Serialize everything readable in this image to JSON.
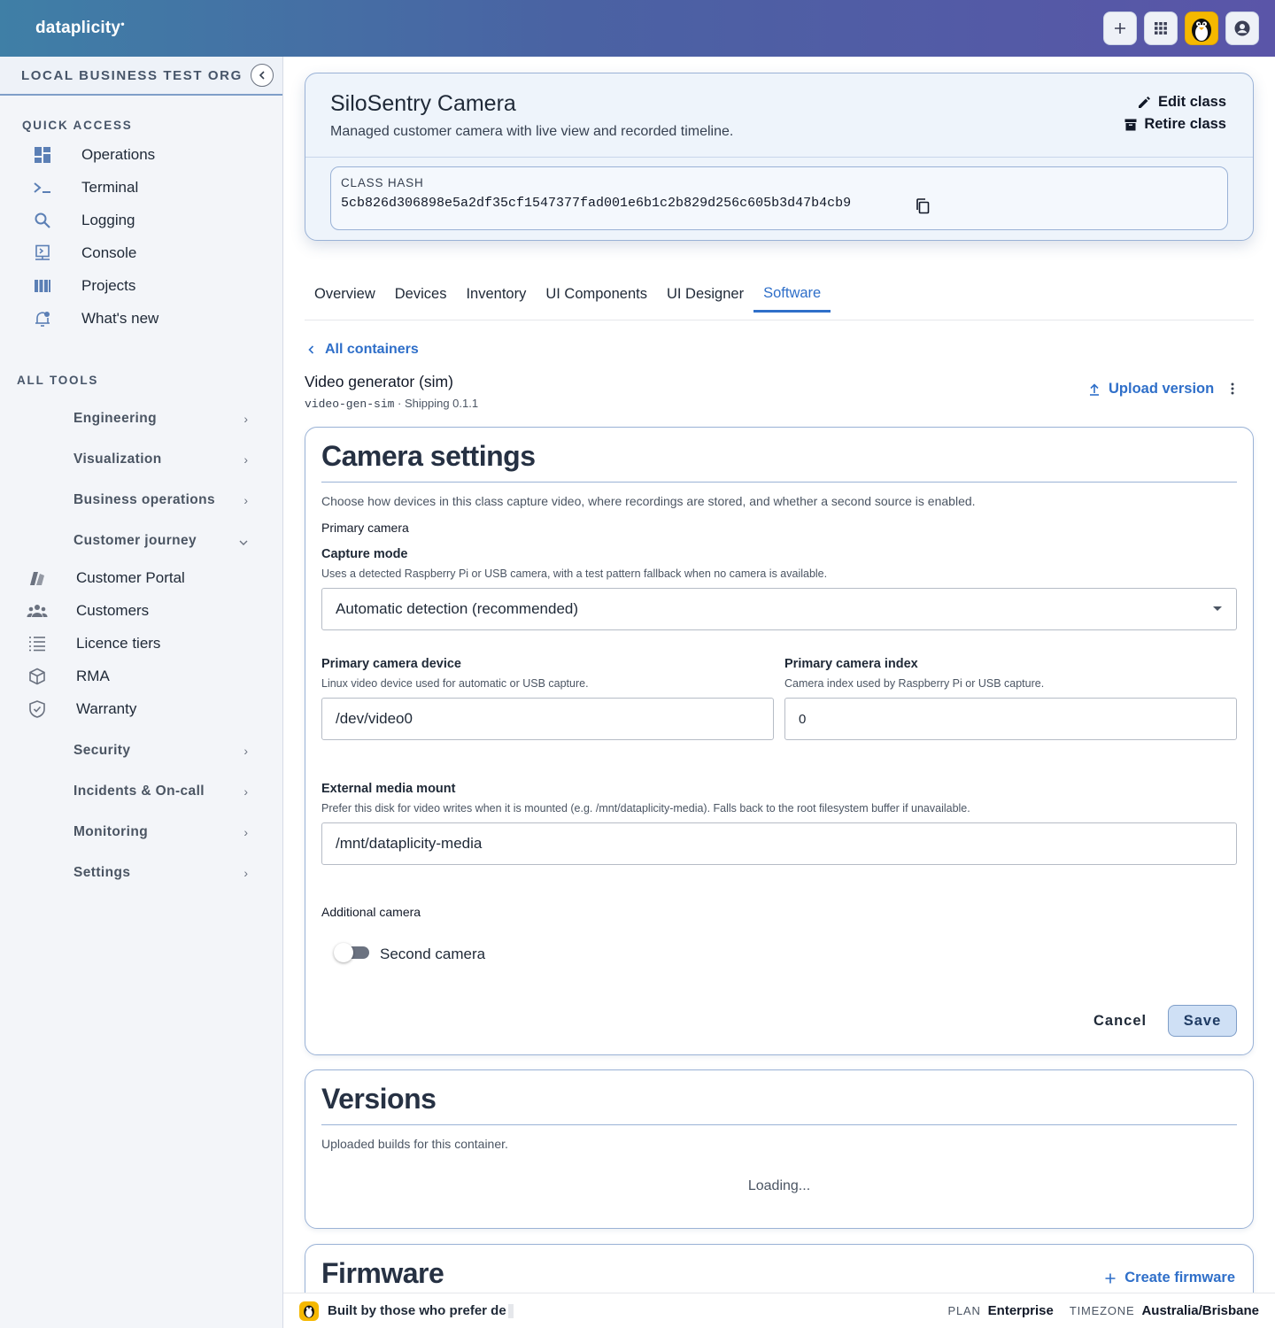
{
  "app": {
    "brand": "dataplicity"
  },
  "colors": {
    "accent": "#2f6fc9",
    "topbar_start": "#3f7fa6",
    "topbar_end": "#5a55a8",
    "panel_border": "#9ab2d6"
  },
  "topbar": {
    "actions": [
      "plus-icon",
      "apps-grid-icon",
      "penguin-avatar",
      "account-icon"
    ]
  },
  "sidebar": {
    "org_name": "LOCAL BUSINESS TEST ORG",
    "quick_access_title": "QUICK ACCESS",
    "quick_access": [
      {
        "label": "Operations",
        "icon": "dashboard-icon"
      },
      {
        "label": "Terminal",
        "icon": "terminal-icon"
      },
      {
        "label": "Logging",
        "icon": "search-icon"
      },
      {
        "label": "Console",
        "icon": "console-icon"
      },
      {
        "label": "Projects",
        "icon": "columns-icon"
      },
      {
        "label": "What's new",
        "icon": "bell-icon"
      }
    ],
    "all_tools_title": "ALL TOOLS",
    "groups": {
      "engineering": "Engineering",
      "visualization": "Visualization",
      "business_operations": "Business operations",
      "customer_journey": "Customer journey",
      "security": "Security",
      "incidents": "Incidents & On-call",
      "monitoring": "Monitoring",
      "settings": "Settings"
    },
    "customer_journey_items": [
      {
        "label": "Customer Portal",
        "icon": "portal-icon"
      },
      {
        "label": "Customers",
        "icon": "people-icon"
      },
      {
        "label": "Licence tiers",
        "icon": "list-icon"
      },
      {
        "label": "RMA",
        "icon": "box-icon"
      },
      {
        "label": "Warranty",
        "icon": "shield-icon"
      }
    ]
  },
  "class": {
    "title": "SiloSentry Camera",
    "description": "Managed customer camera with live view and recorded timeline.",
    "edit_label": "Edit class",
    "retire_label": "Retire class",
    "hash_label": "CLASS HASH",
    "hash_value": "5cb826d306898e5a2df35cf1547377fad001e6b1c2b829d256c605b3d47b4cb9"
  },
  "tabs": [
    "Overview",
    "Devices",
    "Inventory",
    "UI Components",
    "UI Designer",
    "Software"
  ],
  "active_tab": "Software",
  "container": {
    "back_label": "All containers",
    "name": "Video generator (sim)",
    "slug": "video-gen-sim",
    "status": " · Shipping 0.1.1",
    "upload_label": "Upload version"
  },
  "camera_settings": {
    "title": "Camera settings",
    "description": "Choose how devices in this class capture video, where recordings are stored, and whether a second source is enabled.",
    "primary_heading": "Primary camera",
    "capture_mode": {
      "label": "Capture mode",
      "help": "Uses a detected Raspberry Pi or USB camera, with a test pattern fallback when no camera is available.",
      "value": "Automatic detection (recommended)"
    },
    "device": {
      "label": "Primary camera device",
      "help": "Linux video device used for automatic or USB capture.",
      "value": "/dev/video0"
    },
    "index": {
      "label": "Primary camera index",
      "help": "Camera index used by Raspberry Pi or USB capture.",
      "value": "0"
    },
    "media": {
      "label": "External media mount",
      "help": "Prefer this disk for video writes when it is mounted (e.g. /mnt/dataplicity-media). Falls back to the root filesystem buffer if unavailable.",
      "value": "/mnt/dataplicity-media"
    },
    "additional_heading": "Additional camera",
    "second_camera_label": "Second camera",
    "second_camera_enabled": false,
    "cancel_label": "Cancel",
    "save_label": "Save"
  },
  "versions": {
    "title": "Versions",
    "description": "Uploaded builds for this container.",
    "loading": "Loading..."
  },
  "firmware": {
    "title": "Firmware",
    "create_label": "Create firmware"
  },
  "footer": {
    "tagline": "Built by those who prefer de",
    "plan_key": "PLAN",
    "plan_value": "Enterprise",
    "tz_key": "TIMEZONE",
    "tz_value": "Australia/Brisbane"
  }
}
